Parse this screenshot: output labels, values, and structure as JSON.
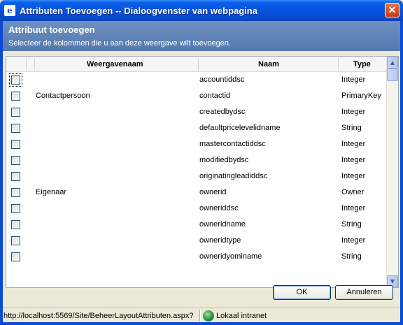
{
  "window": {
    "title": "Attributen Toevoegen -- Dialoogvenster van webpagina",
    "close_glyph": "✕"
  },
  "header": {
    "title": "Attribuut toevoegen",
    "subtitle": "Selecteer de kolommen die u aan deze weergave wilt toevoegen."
  },
  "grid": {
    "columns": {
      "display": "Weergavenaam",
      "name": "Naam",
      "type": "Type"
    },
    "rows": [
      {
        "display": "",
        "name": "accountiddsc",
        "type": "Integer",
        "checked": false
      },
      {
        "display": "Contactpersoon",
        "name": "contactid",
        "type": "PrimaryKey",
        "checked": false
      },
      {
        "display": "",
        "name": "createdbydsc",
        "type": "Integer",
        "checked": false
      },
      {
        "display": "",
        "name": "defaultpricelevelidname",
        "type": "String",
        "checked": false
      },
      {
        "display": "",
        "name": "mastercontactiddsc",
        "type": "Integer",
        "checked": false
      },
      {
        "display": "",
        "name": "modifiedbydsc",
        "type": "Integer",
        "checked": false
      },
      {
        "display": "",
        "name": "originatingleadiddsc",
        "type": "Integer",
        "checked": false
      },
      {
        "display": "Eigenaar",
        "name": "ownerid",
        "type": "Owner",
        "checked": false
      },
      {
        "display": "",
        "name": "owneriddsc",
        "type": "Integer",
        "checked": false
      },
      {
        "display": "",
        "name": "owneridname",
        "type": "String",
        "checked": false
      },
      {
        "display": "",
        "name": "owneridtype",
        "type": "Integer",
        "checked": false
      },
      {
        "display": "",
        "name": "owneridyominame",
        "type": "String",
        "checked": false
      }
    ]
  },
  "buttons": {
    "ok": "OK",
    "cancel": "Annuleren"
  },
  "status": {
    "url": "http://localhost:5569/Site/BeheerLayoutAttributen.aspx?",
    "zone": "Lokaal intranet",
    "zone_icon": "globe-icon"
  },
  "colors": {
    "title_bar": "#0654e0",
    "header_band": "#6585b8",
    "dialog_bg": "#ece9d8"
  }
}
